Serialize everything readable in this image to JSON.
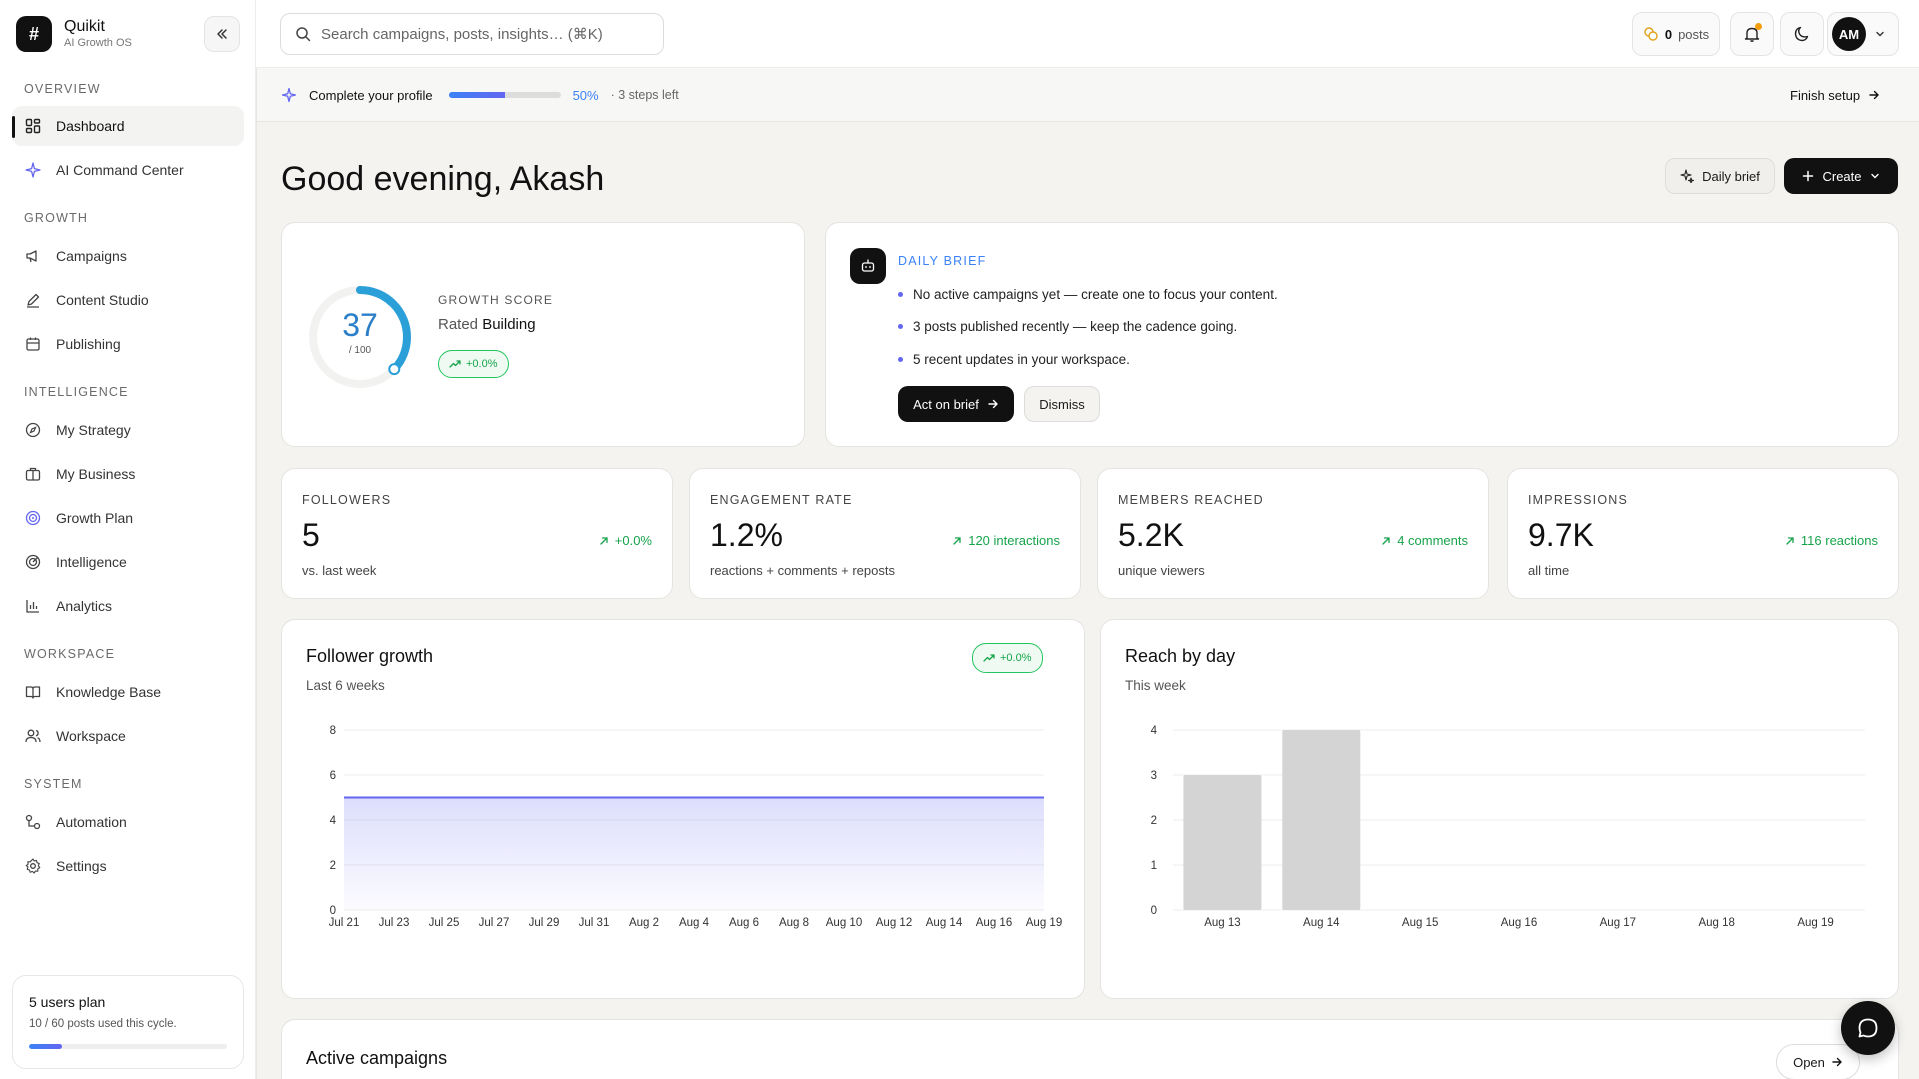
{
  "brand": {
    "name": "Quikit",
    "subtitle": "AI Growth OS",
    "logo_glyph": "#"
  },
  "sidebar": {
    "sections": {
      "overview": "OVERVIEW",
      "growth": "GROWTH",
      "intelligence": "INTELLIGENCE",
      "workspace": "WORKSPACE",
      "system": "SYSTEM"
    },
    "items": {
      "dashboard": {
        "label": "Dashboard",
        "icon": "grid-icon"
      },
      "ai_command": {
        "label": "AI Command Center",
        "icon": "sparkle-icon"
      },
      "campaigns": {
        "label": "Campaigns",
        "icon": "megaphone-icon"
      },
      "content_studio": {
        "label": "Content Studio",
        "icon": "pen-icon"
      },
      "publishing": {
        "label": "Publishing",
        "icon": "calendar-icon"
      },
      "my_strategy": {
        "label": "My Strategy",
        "icon": "compass-icon"
      },
      "my_business": {
        "label": "My Business",
        "icon": "briefcase-icon"
      },
      "growth_plan": {
        "label": "Growth Plan",
        "icon": "target-icon"
      },
      "intelligence": {
        "label": "Intelligence",
        "icon": "radar-icon"
      },
      "analytics": {
        "label": "Analytics",
        "icon": "bar-chart-icon"
      },
      "knowledge_base": {
        "label": "Knowledge Base",
        "icon": "book-icon"
      },
      "workspace": {
        "label": "Workspace",
        "icon": "users-icon"
      },
      "automation": {
        "label": "Automation",
        "icon": "workflow-icon"
      },
      "settings": {
        "label": "Settings",
        "icon": "gear-icon"
      }
    },
    "plan": {
      "title": "5 users plan",
      "usage": "10 / 60 posts used this cycle.",
      "progress": 0.167
    }
  },
  "topbar": {
    "search_placeholder": "Search campaigns, posts, insights…  (⌘K)",
    "posts_count": "0",
    "posts_label": "posts",
    "avatar_initials": "AM"
  },
  "banner": {
    "title": "Complete your profile",
    "progress": 0.5,
    "percent": "50%",
    "steps": "· 3 steps left",
    "finish": "Finish setup"
  },
  "main": {
    "greeting": "Good evening, Akash",
    "daily_brief_btn": "Daily brief",
    "create_btn": "Create",
    "score": {
      "value": "37",
      "max": "/ 100",
      "fraction": 0.37,
      "label": "GROWTH SCORE",
      "rated_prefix": "Rated",
      "rated": "Building",
      "delta": "+0.0%"
    },
    "brief": {
      "label": "DAILY BRIEF",
      "items": [
        "No active campaigns yet — create one to focus your content.",
        "3 posts published recently — keep the cadence going.",
        "5 recent updates in your workspace."
      ],
      "act_btn": "Act on brief",
      "dismiss_btn": "Dismiss"
    },
    "stats": [
      {
        "label": "FOLLOWERS",
        "value": "5",
        "delta": "+0.0%",
        "sub": "vs. last week"
      },
      {
        "label": "ENGAGEMENT RATE",
        "value": "1.2%",
        "delta": "120 interactions",
        "sub": "reactions + comments + reposts"
      },
      {
        "label": "MEMBERS REACHED",
        "value": "5.2K",
        "delta": "4 comments",
        "sub": "unique viewers"
      },
      {
        "label": "IMPRESSIONS",
        "value": "9.7K",
        "delta": "116 reactions",
        "sub": "all time"
      }
    ],
    "campaigns": {
      "title": "Active campaigns",
      "open_btn": "Open"
    }
  },
  "colors": {
    "accent": "#3b82f6",
    "indigo": "#6366f1",
    "positive": "#16a34a",
    "dark": "#111111"
  },
  "chart_data": [
    {
      "type": "area",
      "title": "Follower growth",
      "subtitle": "Last 6 weeks",
      "badge": "+0.0%",
      "x": [
        "Jul 21",
        "Jul 23",
        "Jul 25",
        "Jul 27",
        "Jul 29",
        "Jul 31",
        "Aug 2",
        "Aug 4",
        "Aug 6",
        "Aug 8",
        "Aug 10",
        "Aug 12",
        "Aug 14",
        "Aug 16",
        "Aug 19"
      ],
      "series": [
        {
          "values": [
            5,
            5,
            5,
            5,
            5,
            5,
            5,
            5,
            5,
            5,
            5,
            5,
            5,
            5,
            5
          ]
        }
      ],
      "ylim": [
        0,
        8
      ],
      "yticks": [
        0,
        2,
        4,
        6,
        8
      ],
      "grid": true
    },
    {
      "type": "bar",
      "title": "Reach by day",
      "subtitle": "This week",
      "categories": [
        "Aug 13",
        "Aug 14",
        "Aug 15",
        "Aug 16",
        "Aug 17",
        "Aug 18",
        "Aug 19"
      ],
      "values": [
        3,
        4,
        0,
        0,
        0,
        0,
        0
      ],
      "ylim": [
        0,
        4
      ],
      "yticks": [
        0,
        1,
        2,
        3,
        4
      ],
      "grid": true
    }
  ]
}
